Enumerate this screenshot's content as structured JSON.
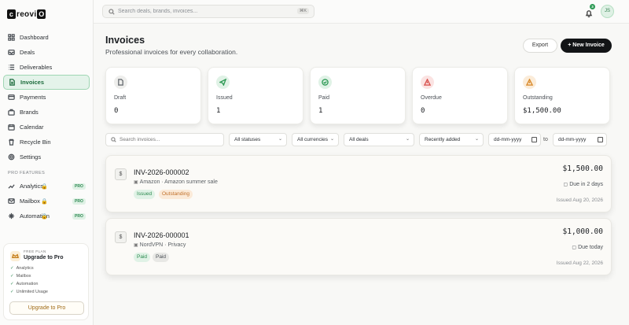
{
  "brand": {
    "logo_left": "c",
    "logo_mid": "reovi",
    "logo_right": "O"
  },
  "search": {
    "placeholder": "Search deals, brands, invoices...",
    "shortcut": "⌘K"
  },
  "notifications": {
    "count": "3"
  },
  "user": {
    "initials": "JS"
  },
  "sidebar": {
    "items": [
      {
        "label": "Dashboard",
        "icon": "grid-icon"
      },
      {
        "label": "Deals",
        "icon": "inbox-icon"
      },
      {
        "label": "Deliverables",
        "icon": "list-icon"
      },
      {
        "label": "Invoices",
        "icon": "document-icon",
        "active": true
      },
      {
        "label": "Payments",
        "icon": "card-icon"
      },
      {
        "label": "Brands",
        "icon": "briefcase-icon"
      },
      {
        "label": "Calendar",
        "icon": "calendar-icon"
      },
      {
        "label": "Recycle Bin",
        "icon": "trash-icon"
      },
      {
        "label": "Settings",
        "icon": "gear-icon"
      }
    ],
    "pro_label": "PRO FEATURES",
    "pro_items": [
      {
        "label": "Analytics",
        "badge": "PRO"
      },
      {
        "label": "Mailbox",
        "badge": "PRO"
      },
      {
        "label": "Automation",
        "badge": "PRO"
      }
    ],
    "upgrade": {
      "plan": "FREE PLAN",
      "title": "Upgrade to Pro",
      "features": [
        "Analytics",
        "Mailbox",
        "Automation",
        "Unlimited Usage"
      ],
      "button": "Upgrade to Pro"
    }
  },
  "page": {
    "title": "Invoices",
    "subtitle": "Professional invoices for every collaboration.",
    "export_label": "Export",
    "new_label": "New Invoice"
  },
  "stats": [
    {
      "label": "Draft",
      "value": "0",
      "color": "#6b7075"
    },
    {
      "label": "Issued",
      "value": "1",
      "color": "#2e9a55"
    },
    {
      "label": "Paid",
      "value": "1",
      "color": "#2e9a55"
    },
    {
      "label": "Overdue",
      "value": "0",
      "color": "#d9534f"
    },
    {
      "label": "Outstanding",
      "value": "$1,500.00",
      "color": "#d98a2b"
    }
  ],
  "filters": {
    "search_placeholder": "Search invoices...",
    "status": "All statuses",
    "currency": "All currencies",
    "deals": "All deals",
    "sort": "Recently added",
    "date_from": "dd-mm-yyyy",
    "to_label": "to",
    "date_to": "dd-mm-yyyy"
  },
  "invoices": [
    {
      "number": "INV-2026-000002",
      "brand_deal": "Amazon · Amazon summer sale",
      "tags": [
        "Issued",
        "Outstanding"
      ],
      "amount": "$1,500.00",
      "due": "Due in 2 days",
      "issued": "Issued Aug 20, 2026"
    },
    {
      "number": "INV-2026-000001",
      "brand_deal": "NordVPN · Privacy",
      "tags": [
        "Paid",
        "Paid"
      ],
      "amount": "$1,000.00",
      "due": "Due today",
      "issued": "Issued Aug 22, 2026"
    }
  ]
}
